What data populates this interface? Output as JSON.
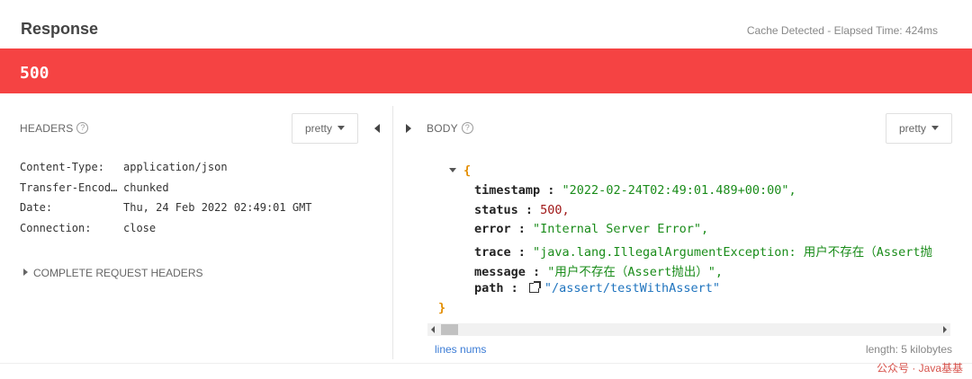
{
  "response": {
    "title": "Response",
    "meta": "Cache Detected - Elapsed Time: 424ms",
    "status_code": "500",
    "status_color": "#f54343"
  },
  "headers_panel": {
    "label": "HEADERS",
    "help_icon": "question-circle-icon",
    "format": "pretty",
    "rows": [
      {
        "key": "Content-Type:",
        "value": "application/json"
      },
      {
        "key": "Transfer-Encod…",
        "value": "chunked"
      },
      {
        "key": "Date:",
        "value": "Thu, 24 Feb 2022 02:49:01 GMT"
      },
      {
        "key": "Connection:",
        "value": "close"
      }
    ],
    "complete_label": "COMPLETE REQUEST HEADERS"
  },
  "body_panel": {
    "label": "BODY",
    "help_icon": "question-circle-icon",
    "format": "pretty",
    "open_brace": "{",
    "close_brace": "}",
    "fields": [
      {
        "key": "timestamp",
        "value": "\"2022-02-24T02:49:01.489+00:00\",",
        "type": "string"
      },
      {
        "key": "status",
        "value": "500,",
        "type": "number"
      },
      {
        "key": "error",
        "value": "\"Internal Server Error\",",
        "type": "string"
      },
      {
        "key": "trace",
        "value": "\"java.lang.IllegalArgumentException: 用户不存在（Assert抛",
        "type": "string"
      },
      {
        "key": "message",
        "value": "\"用户不存在（Assert抛出）\",",
        "type": "string"
      },
      {
        "key": "path",
        "value": "\"/assert/testWithAssert\"",
        "type": "link"
      }
    ],
    "lines_nums": "lines nums",
    "length": "length: 5 kilobytes"
  },
  "watermark": "公众号 · Java基基"
}
